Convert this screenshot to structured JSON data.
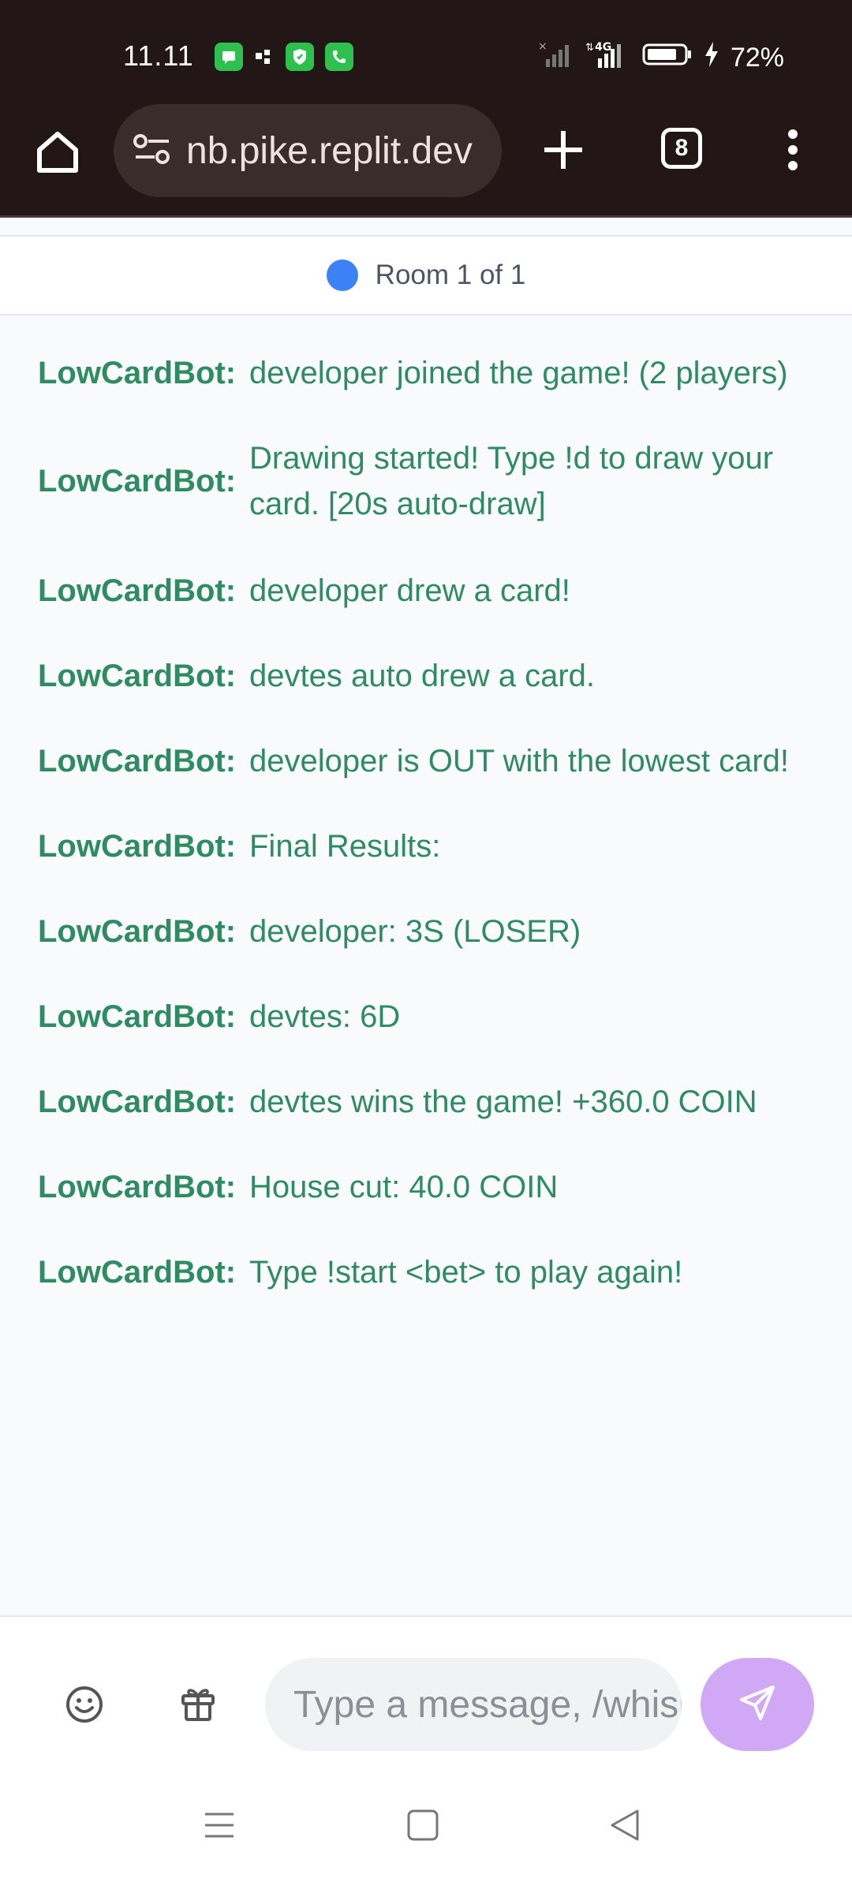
{
  "status_bar": {
    "time": "11.11",
    "network": "4G",
    "battery": "72%"
  },
  "browser": {
    "url": "nb.pike.replit.dev",
    "tab_count": "8"
  },
  "room": {
    "label": "Room 1 of 1",
    "dot_color": "#3b82f6"
  },
  "messages": [
    {
      "sender": "LowCardBot:",
      "text": "developer joined the game! (2 players)"
    },
    {
      "sender": "LowCardBot:",
      "text": "Drawing started! Type !d to draw your card. [20s auto-draw]"
    },
    {
      "sender": "LowCardBot:",
      "text": "developer drew a card!"
    },
    {
      "sender": "LowCardBot:",
      "text": "devtes auto drew a card."
    },
    {
      "sender": "LowCardBot:",
      "text": "developer is OUT with the lowest card!"
    },
    {
      "sender": "LowCardBot:",
      "text": "Final Results:"
    },
    {
      "sender": "LowCardBot:",
      "text": "developer: 3S (LOSER)"
    },
    {
      "sender": "LowCardBot:",
      "text": "devtes: 6D"
    },
    {
      "sender": "LowCardBot:",
      "text": "devtes wins the game! +360.0 COIN"
    },
    {
      "sender": "LowCardBot:",
      "text": "House cut: 40.0 COIN"
    },
    {
      "sender": "LowCardBot:",
      "text": "Type !start <bet> to play again!"
    }
  ],
  "composer": {
    "placeholder": "Type a message, /whisper",
    "emoji_icon": "smiley-icon",
    "gift_icon": "gift-icon",
    "send_icon": "send-icon"
  },
  "colors": {
    "bot_text": "#2e8b62",
    "send_button": "#d0a8f5",
    "chrome_bg": "#221617"
  }
}
